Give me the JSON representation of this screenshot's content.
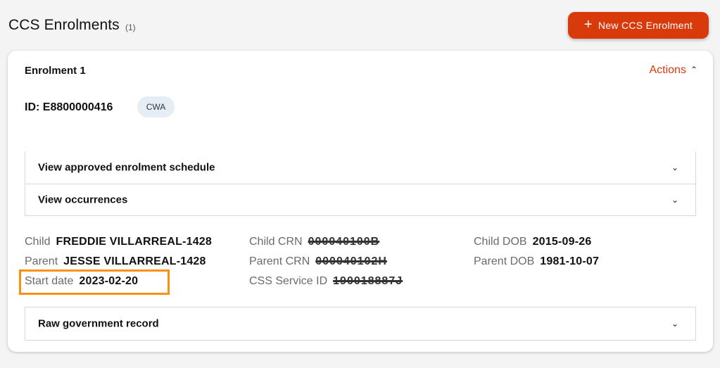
{
  "header": {
    "title": "CCS Enrolments",
    "count": "(1)",
    "new_button_icon": "plus-icon",
    "new_button_label": "New CCS Enrolment"
  },
  "enrolment": {
    "title": "Enrolment 1",
    "actions_label": "Actions",
    "actions_icon": "chevron-up-icon",
    "id_text": "ID: E8800000416",
    "badge": "CWA",
    "accordions": [
      {
        "label": "View approved enrolment schedule",
        "icon": "chevron-down-icon"
      },
      {
        "label": "View occurrences",
        "icon": "chevron-down-icon"
      },
      {
        "label": "Raw government record",
        "icon": "chevron-down-icon"
      }
    ],
    "fields": {
      "child": {
        "label": "Child",
        "value": "FREDDIE VILLARREAL-1428"
      },
      "parent": {
        "label": "Parent",
        "value": "JESSE VILLARREAL-1428"
      },
      "start_date": {
        "label": "Start date",
        "value": "2023-02-20"
      },
      "child_crn": {
        "label": "Child CRN",
        "value": "000040100B"
      },
      "parent_crn": {
        "label": "Parent CRN",
        "value": "000040102H"
      },
      "service_id": {
        "label": "CSS Service ID",
        "value": "190018887J"
      },
      "child_dob": {
        "label": "Child DOB",
        "value": "2015-09-26"
      },
      "parent_dob": {
        "label": "Parent DOB",
        "value": "1981-10-07"
      }
    }
  },
  "colors": {
    "accent": "#d93a0c",
    "highlight": "#f7910f",
    "badge_bg": "#e5edf5"
  }
}
